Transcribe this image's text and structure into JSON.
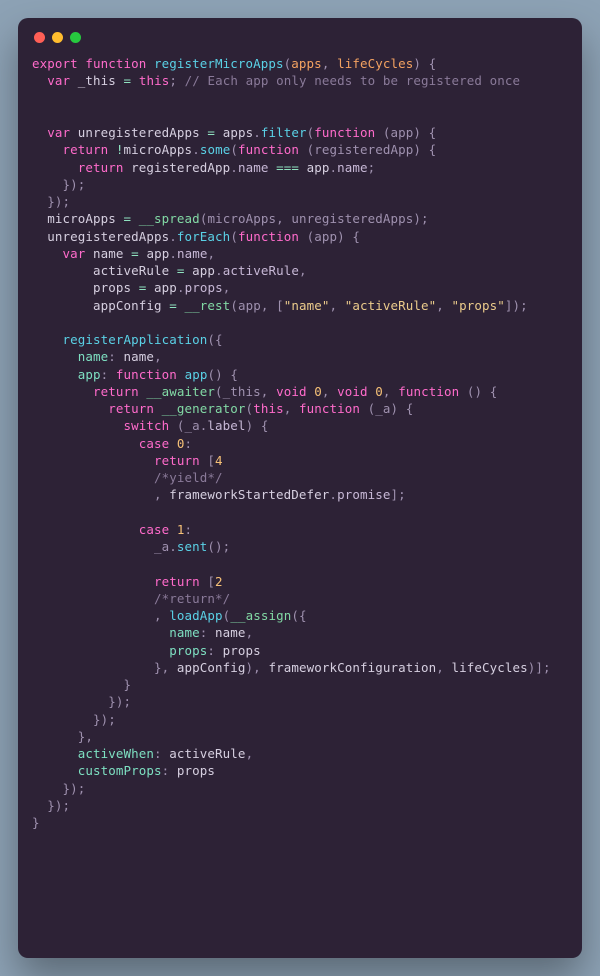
{
  "window": {
    "buttons": [
      "close",
      "minimize",
      "zoom"
    ]
  },
  "code": {
    "fn_decl_1": "export function ",
    "fn_name": "registerMicroApps",
    "fn_params_open": "(",
    "p_apps": "apps",
    "p_lifeCycles": "lifeCycles",
    "fn_params_close": ") {",
    "l2_var": "  var ",
    "l2_this": "_this",
    "l2_eq": " = ",
    "l2_thiskw": "this",
    "l2_semi": "; ",
    "l2_cmt": "// Each app only needs to be registered once",
    "blank": "",
    "l5_var": "  var ",
    "l5_name": "unregisteredApps",
    "l5_eq": " = ",
    "l5_apps": "apps",
    "l5_dot": ".",
    "l5_filter": "filter",
    "l5_open": "(",
    "l5_fnkw": "function ",
    "l5_p": "(app) {",
    "l6_ret": "    return ",
    "l6_not": "!",
    "l6_micro": "microApps",
    "l6_some": "some",
    "l6_open": "(",
    "l6_fnkw": "function ",
    "l6_p": "(registeredApp) {",
    "l7_ret": "      return ",
    "l7_reg": "registeredApp",
    "l7_name": "name",
    "l7_eqeq": " === ",
    "l7_app": "app",
    "l7_semi": ";",
    "l8": "    });",
    "l9": "  });",
    "l10_a": "  microApps",
    "l10_eq": " = ",
    "l10_spread": "__spread",
    "l10_b": "(microApps, unregisteredApps);",
    "l11_a": "  unregisteredApps",
    "l11_forEach": "forEach",
    "l11_open": "(",
    "l11_fnkw": "function ",
    "l11_p": "(app) {",
    "l12_var": "    var ",
    "l12_name": "name",
    "l12_eq": " = ",
    "l12_app": "app",
    "l12_comma": ",",
    "l13_pad": "        ",
    "l13_ar": "activeRule",
    "l13_eq": " = ",
    "l13_app": "app",
    "l13_prop": "activeRule",
    "l14_props": "props",
    "l14_prop": "props",
    "l15_ac": "appConfig",
    "l15_rest": "__rest",
    "l15_open": "(app, [",
    "l15_s1": "\"name\"",
    "l15_s2": "\"activeRule\"",
    "l15_s3": "\"props\"",
    "l15_close": "]);",
    "l17_regapp": "    registerApplication",
    "l17_open": "({",
    "l18_k": "      name",
    "l18_v": "name",
    "l19_k": "      app",
    "l19_fnkw": "function ",
    "l19_fn": "app",
    "l19_p": "() {",
    "l20_ret": "        return ",
    "l20_aw": "__awaiter",
    "l20_open": "(_this, ",
    "l20_void": "void",
    "l20_zero": "0",
    "l20_fnkw": "function ",
    "l20_p": "() {",
    "l21_ret": "          return ",
    "l21_gen": "__generator",
    "l21_open": "(",
    "l21_this": "this",
    "l21_fnkw": "function ",
    "l21_p": "(_a) {",
    "l22_sw": "            switch ",
    "l22_open": "(_a.",
    "l22_label": "label",
    "l22_close": ") {",
    "l23_case": "              case ",
    "l23_n": "0",
    "l23_colon": ":",
    "l24_ret": "                return ",
    "l24_open": "[",
    "l24_n": "4",
    "l25_cmt": "                /*yield*/",
    "l26_pad": "                , ",
    "l26_fsd": "frameworkStartedDefer",
    "l26_prom": "promise",
    "l26_close": "];",
    "l28_case": "              case ",
    "l28_n": "1",
    "l28_colon": ":",
    "l29_pad": "                _a.",
    "l29_sent": "sent",
    "l29_call": "();",
    "l31_ret": "                return ",
    "l31_open": "[",
    "l31_n": "2",
    "l32_cmt": "                /*return*/",
    "l33_pad": "                , ",
    "l33_load": "loadApp",
    "l33_open": "(",
    "l33_assign": "__assign",
    "l33_brace": "({",
    "l34_k": "                  name",
    "l34_v": "name",
    "l35_k": "                  props",
    "l35_v": "props",
    "l36_pad": "                }, ",
    "l36_ac": "appConfig",
    "l36_fc": "frameworkConfiguration",
    "l36_lc": "lifeCycles",
    "l36_close": ")];",
    "l37": "            }",
    "l38": "          });",
    "l39": "        });",
    "l40": "      },",
    "l41_k": "      activeWhen",
    "l41_v": "activeRule",
    "l42_k": "      customProps",
    "l42_v": "props",
    "l43": "    });",
    "l44": "  });",
    "l45": "}"
  }
}
